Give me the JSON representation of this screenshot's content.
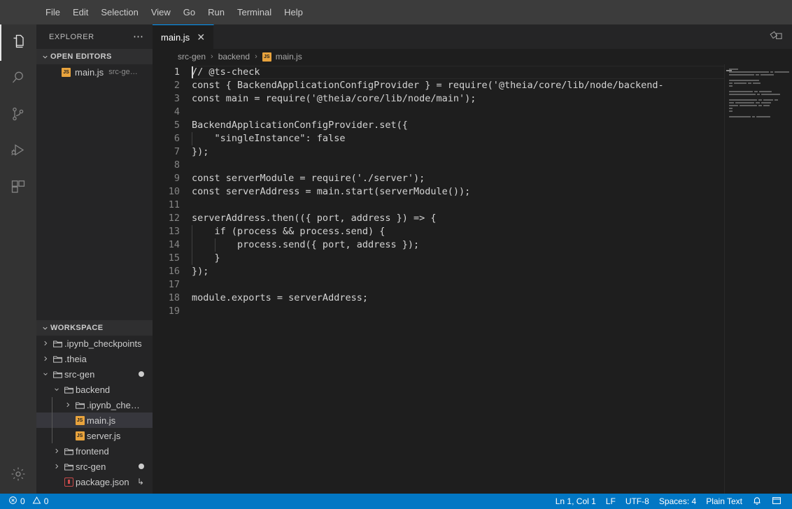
{
  "window": {
    "title": "main.js",
    "theme_bg": "#1e1e1e",
    "accent": "#0097fb",
    "statusbar_bg": "#0277c4"
  },
  "menubar": {
    "items": [
      {
        "label": "File"
      },
      {
        "label": "Edit"
      },
      {
        "label": "Selection"
      },
      {
        "label": "View"
      },
      {
        "label": "Go"
      },
      {
        "label": "Run"
      },
      {
        "label": "Terminal"
      },
      {
        "label": "Help"
      }
    ]
  },
  "activitybar": {
    "items": [
      {
        "name": "explorer",
        "icon": "files-icon",
        "active": true
      },
      {
        "name": "search",
        "icon": "search-icon",
        "active": false
      },
      {
        "name": "source-control",
        "icon": "source-control-icon",
        "active": false
      },
      {
        "name": "run-and-debug",
        "icon": "run-debug-icon",
        "active": false
      },
      {
        "name": "extensions",
        "icon": "extensions-icon",
        "active": false
      }
    ],
    "bottom": [
      {
        "name": "manage-settings",
        "icon": "gear-icon"
      }
    ]
  },
  "sidebar": {
    "title": "EXPLORER",
    "more_label": "⋯",
    "open_editors": {
      "header": "OPEN EDITORS",
      "expanded": true,
      "items": [
        {
          "name": "main.js",
          "path": "src-ge…",
          "icon": "js-file-icon"
        }
      ]
    },
    "workspace": {
      "header": "WORKSPACE",
      "expanded": true,
      "items": [
        {
          "label": ".ipynb_checkpoints",
          "type": "folder",
          "depth": 0,
          "expanded": false,
          "badge": ""
        },
        {
          "label": ".theia",
          "type": "folder",
          "depth": 0,
          "expanded": false,
          "badge": ""
        },
        {
          "label": "src-gen",
          "type": "folder",
          "depth": 0,
          "expanded": true,
          "badge": "dot"
        },
        {
          "label": "backend",
          "type": "folder",
          "depth": 1,
          "expanded": true,
          "badge": ""
        },
        {
          "label": ".ipynb_checkp…",
          "type": "folder",
          "depth": 2,
          "expanded": false,
          "badge": ""
        },
        {
          "label": "main.js",
          "type": "js",
          "depth": 2,
          "selected": true,
          "badge": ""
        },
        {
          "label": "server.js",
          "type": "js",
          "depth": 2,
          "badge": ""
        },
        {
          "label": "frontend",
          "type": "folder",
          "depth": 1,
          "expanded": false,
          "badge": ""
        },
        {
          "label": "src-gen",
          "type": "folder",
          "depth": 1,
          "expanded": false,
          "badge": "dot"
        },
        {
          "label": "package.json",
          "type": "json",
          "depth": 1,
          "badge": "↳"
        }
      ]
    }
  },
  "editor": {
    "tabs": [
      {
        "label": "main.js",
        "icon": "js-file-icon",
        "active": true,
        "close_label": "✕"
      }
    ],
    "actions": [
      {
        "name": "split-editor-icon",
        "label": ""
      }
    ],
    "breadcrumbs": [
      {
        "label": "src-gen",
        "icon": ""
      },
      {
        "label": "backend",
        "icon": ""
      },
      {
        "label": "main.js",
        "icon": "js-file-icon"
      }
    ],
    "breadcrumb_separator": "›",
    "lines": [
      {
        "n": 1,
        "text": "// @ts-check",
        "current": true,
        "caret": true,
        "indents": []
      },
      {
        "n": 2,
        "text": "const { BackendApplicationConfigProvider } = require('@theia/core/lib/node/backend-",
        "indents": []
      },
      {
        "n": 3,
        "text": "const main = require('@theia/core/lib/node/main');",
        "indents": []
      },
      {
        "n": 4,
        "text": "",
        "indents": []
      },
      {
        "n": 5,
        "text": "BackendApplicationConfigProvider.set({",
        "indents": []
      },
      {
        "n": 6,
        "text": "    \"singleInstance\": false",
        "indents": [
          0
        ]
      },
      {
        "n": 7,
        "text": "});",
        "indents": []
      },
      {
        "n": 8,
        "text": "",
        "indents": []
      },
      {
        "n": 9,
        "text": "const serverModule = require('./server');",
        "indents": []
      },
      {
        "n": 10,
        "text": "const serverAddress = main.start(serverModule());",
        "indents": []
      },
      {
        "n": 11,
        "text": "",
        "indents": []
      },
      {
        "n": 12,
        "text": "serverAddress.then(({ port, address }) => {",
        "indents": []
      },
      {
        "n": 13,
        "text": "    if (process && process.send) {",
        "indents": [
          0
        ]
      },
      {
        "n": 14,
        "text": "        process.send({ port, address });",
        "indents": [
          0,
          1
        ]
      },
      {
        "n": 15,
        "text": "    }",
        "indents": [
          0
        ]
      },
      {
        "n": 16,
        "text": "});",
        "indents": []
      },
      {
        "n": 17,
        "text": "",
        "indents": []
      },
      {
        "n": 18,
        "text": "module.exports = serverAddress;",
        "indents": []
      },
      {
        "n": 19,
        "text": "",
        "indents": []
      }
    ],
    "minimap": {
      "visible": true,
      "rows": [
        [
          14
        ],
        [
          70,
          4,
          26
        ],
        [
          40,
          5,
          22
        ],
        [],
        [
          48
        ],
        [
          6,
          20,
          5,
          12
        ],
        [
          5
        ],
        [],
        [
          38,
          5,
          20
        ],
        [
          42,
          5,
          30
        ],
        [],
        [
          44,
          6,
          16,
          5
        ],
        [
          8,
          30,
          6,
          16
        ],
        [
          14,
          28,
          6,
          10
        ],
        [
          6
        ],
        [
          5
        ],
        [],
        [
          34,
          5,
          22
        ]
      ]
    }
  },
  "statusbar": {
    "left": [
      {
        "name": "problems-errors",
        "icon": "error-circle-icon",
        "value": "0"
      },
      {
        "name": "problems-warnings",
        "icon": "warning-triangle-icon",
        "value": "0"
      }
    ],
    "right": [
      {
        "name": "cursor-position",
        "label": "Ln 1, Col 1"
      },
      {
        "name": "end-of-line",
        "label": "LF"
      },
      {
        "name": "encoding",
        "label": "UTF-8"
      },
      {
        "name": "indentation",
        "label": "Spaces: 4"
      },
      {
        "name": "language-mode",
        "label": "Plain Text"
      },
      {
        "name": "notifications",
        "label": "",
        "icon": "bell-icon"
      },
      {
        "name": "toggle-panel",
        "label": "",
        "icon": "layout-panel-icon"
      }
    ]
  }
}
